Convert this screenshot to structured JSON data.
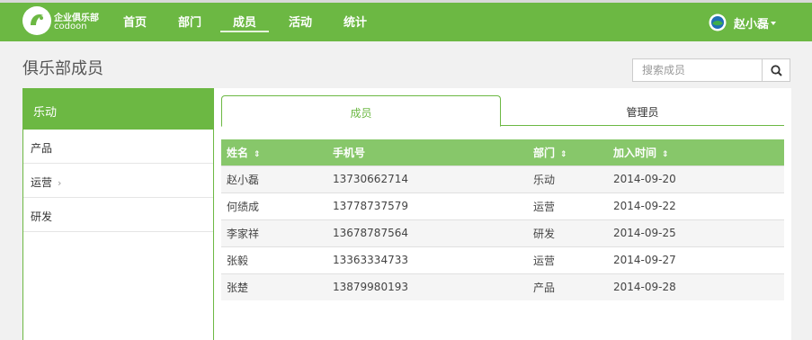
{
  "colors": {
    "brand": "#6cb843",
    "header_row": "#87c76a"
  },
  "header": {
    "brand_cn": "企业俱乐部",
    "brand_en": "codoon",
    "nav": [
      "首页",
      "部门",
      "成员",
      "活动",
      "统计"
    ],
    "active_nav": "成员",
    "user_name": "赵小磊"
  },
  "page": {
    "title": "俱乐部成员"
  },
  "search": {
    "placeholder": "搜索成员",
    "icon": "search-icon"
  },
  "sidebar": {
    "selected": "乐动",
    "items": [
      {
        "label": "产品",
        "has_chevron": false
      },
      {
        "label": "运营",
        "has_chevron": true
      },
      {
        "label": "研发",
        "has_chevron": false
      }
    ]
  },
  "tabs": {
    "members": "成员",
    "admins": "管理员"
  },
  "table": {
    "columns": [
      "姓名",
      "手机号",
      "部门",
      "加入时间"
    ],
    "sort_glyph": "⇕",
    "rows": [
      [
        "赵小磊",
        "13730662714",
        "乐动",
        "2014-09-20"
      ],
      [
        "何绩成",
        "13778737579",
        "运营",
        "2014-09-22"
      ],
      [
        "李家祥",
        "13678787564",
        "研发",
        "2014-09-25"
      ],
      [
        "张毅",
        "13363334733",
        "运营",
        "2014-09-27"
      ],
      [
        "张楚",
        "13879980193",
        "产品",
        "2014-09-28"
      ]
    ]
  }
}
